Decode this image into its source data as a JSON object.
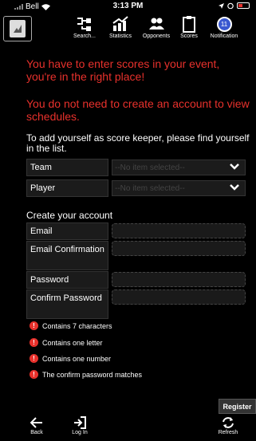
{
  "status": {
    "carrier": "Bell",
    "time": "3:13 PM",
    "battery_color": "#e8312c"
  },
  "toolbar": {
    "items": [
      {
        "label": "Search...",
        "icon": "search-tree-icon"
      },
      {
        "label": "Statistics",
        "icon": "statistics-icon"
      },
      {
        "label": "Opponents",
        "icon": "opponents-icon"
      },
      {
        "label": "Scores",
        "icon": "scores-icon"
      },
      {
        "label": "Notification",
        "icon": "notification-icon",
        "badge": "11"
      }
    ]
  },
  "messages": {
    "primary": "You have to enter scores in your event, you're in the right place!",
    "secondary": "You do not need to create an account to view schedules."
  },
  "instruction": "To add yourself as score keeper, please find yourself in the list.",
  "selects": [
    {
      "label": "Team",
      "placeholder": "--No item selected--"
    },
    {
      "label": "Player",
      "placeholder": "--No item selected--"
    }
  ],
  "account": {
    "title": "Create your account",
    "fields": [
      {
        "label": "Email"
      },
      {
        "label": "Email Confirmation"
      },
      {
        "label": "Password"
      },
      {
        "label": "Confirm Password"
      }
    ]
  },
  "requirements": [
    "Contains 7 characters",
    "Contains one letter",
    "Contains one number",
    "The confirm password matches"
  ],
  "register_label": "Register",
  "bottom": {
    "back": "Back",
    "login": "Log In",
    "refresh": "Refresh"
  },
  "colors": {
    "accent_red": "#e8312c",
    "badge_blue": "#3a58d0",
    "background": "#000000"
  }
}
